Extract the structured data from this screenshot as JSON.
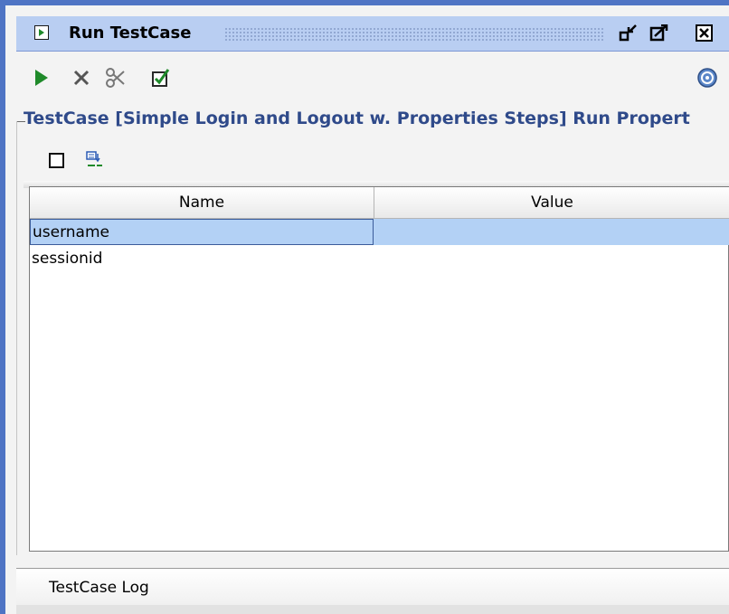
{
  "window": {
    "title": "Run TestCase",
    "title_icon": "run-panel-icon",
    "controls": [
      "minimize-icon",
      "maximize-icon",
      "close-icon"
    ]
  },
  "toolbar": {
    "items": [
      {
        "name": "run-button",
        "icon": "play-icon"
      },
      {
        "name": "cancel-button",
        "icon": "x-icon"
      },
      {
        "name": "options-button",
        "icon": "scissors-icon"
      },
      {
        "name": "validate-button",
        "icon": "checkbox-icon"
      },
      {
        "name": "help-button",
        "icon": "help-icon"
      }
    ]
  },
  "properties_group": {
    "title": "TestCase [Simple Login and Logout w. Properties Steps] Run Propert"
  },
  "properties_toolbar": {
    "items": [
      {
        "name": "clear-button",
        "icon": "square-icon"
      },
      {
        "name": "load-button",
        "icon": "load-properties-icon"
      }
    ]
  },
  "table": {
    "columns": [
      "Name",
      "Value"
    ],
    "rows": [
      {
        "name": "username",
        "value": "",
        "selected": true
      },
      {
        "name": "sessionid",
        "value": "",
        "selected": false
      }
    ]
  },
  "bottom_tabs": {
    "log": "TestCase Log"
  },
  "colors": {
    "title_bar": "#b9cef2",
    "group_title": "#2f4a8a",
    "selection": "#b3d1f5",
    "run_green": "#1f8a2a"
  }
}
